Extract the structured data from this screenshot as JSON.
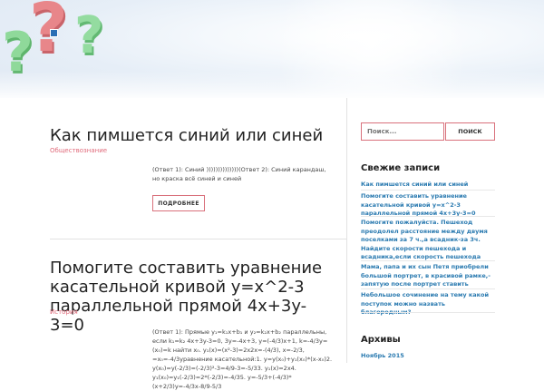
{
  "header": {
    "icons": [
      "question-mark-red",
      "question-mark-green",
      "question-mark-green"
    ]
  },
  "posts": [
    {
      "title": "Как пимшется синий или синей",
      "category": "Обществознание",
      "excerpt": "(Ответ 1): Синий ))))))))))))))(Ответ 2): Синий карандаш, но краска всё синей и синей",
      "more_label": "ПОДРОБНЕЕ"
    },
    {
      "title": "Помогите составить уравнение касательной кривой y=x^2-3 параллельной прямой 4x+3y-3=0",
      "category": "История",
      "excerpt": "(Ответ 1): Прямые y₁=k₁x+b₁ и y₂=k₂x+b₂ параллельны, если k₁=k₂ 4x+3y-3=0, 3y=-4x+3, y=(-4/3)x+1, k=-4/3y=(x₀)=k найти x₀. y₁(x)=(x²-3)=2x2x=-(4/3), x=-2/3, =x₀=-4/3уравнение касательной:1. y=y(x₀)+y₁(x₀)*(x-x₀)2. y(x₀)=y(-2/3)=(-2/3)²-3=4/9-3=-5/33. y₁(x)=2x4. y₁(x₀)=y₁(-2/3)=2*(-2/3)=-4/35. y=-5/3+(-4/3)*(x+2/3)y=-4/3x-8/9-5/3"
    }
  ],
  "sidebar": {
    "search_placeholder": "Поиск...",
    "search_button": "ПОИСК",
    "recent_title": "Свежие записи",
    "recent_items": [
      "Как пимшется синий или синей",
      "Помогите составить уравнение касательной кривой y=x^2-3 параллельной прямой 4x+3y-3=0",
      "Помогите пожалуйста. Пешеход преодолел расстояние между двумя поселками за 7 ч.,а всадник-за 3ч. Найдите скорости пешехода и всадника,если скорость пешехода",
      "Мама, папа и их сын Петя приобрели большой портрет, в красивой рамке,-запятую после портрет ставить",
      "Небольшое сочинение на тему какой поступок можно назвать благородным?"
    ],
    "archives_title": "Архивы",
    "archive_items": [
      "Ноябрь 2015"
    ]
  }
}
